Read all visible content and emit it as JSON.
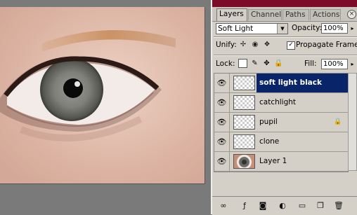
{
  "tabs": [
    {
      "label": "Layers",
      "active": true
    },
    {
      "label": "Channels",
      "active": false
    },
    {
      "label": "Paths",
      "active": false
    },
    {
      "label": "Actions",
      "active": false
    }
  ],
  "close_glyph": "×",
  "blend_mode": "Soft Light",
  "blend_arrow": "▼",
  "opacity_label": "Opacity:",
  "opacity_value": "100%",
  "fill_label": "Fill:",
  "fill_value": "100%",
  "spin_arrow": "▸",
  "unify_label": "Unify:",
  "propagate_label": "Propagate Frame 1",
  "propagate_checked": "✓",
  "lock_label": "Lock:",
  "layers": [
    {
      "name": "soft light black",
      "selected": true,
      "thumb": "transparent",
      "locked": false
    },
    {
      "name": "catchlight",
      "selected": false,
      "thumb": "transparent",
      "locked": false
    },
    {
      "name": "pupil",
      "selected": false,
      "thumb": "transparent",
      "locked": true
    },
    {
      "name": "clone",
      "selected": false,
      "thumb": "transparent",
      "locked": false
    },
    {
      "name": "Layer 1",
      "selected": false,
      "thumb": "photo",
      "locked": false
    }
  ],
  "eye_glyph": "👁",
  "lock_glyph": "🔒",
  "icons": {
    "unify": [
      "unify-position-icon",
      "unify-visibility-icon",
      "unify-style-icon"
    ],
    "lock": [
      "lock-transparency-icon",
      "lock-paint-icon",
      "lock-position-icon",
      "lock-all-icon"
    ],
    "bottom": [
      "link-icon",
      "layer-style-icon",
      "mask-icon",
      "adjustment-layer-icon",
      "new-group-icon",
      "new-layer-icon",
      "delete-icon"
    ]
  },
  "colors": {
    "title_bar": "#7e0a2a",
    "selection": "#0a246a",
    "panel": "#d4d0c8"
  }
}
